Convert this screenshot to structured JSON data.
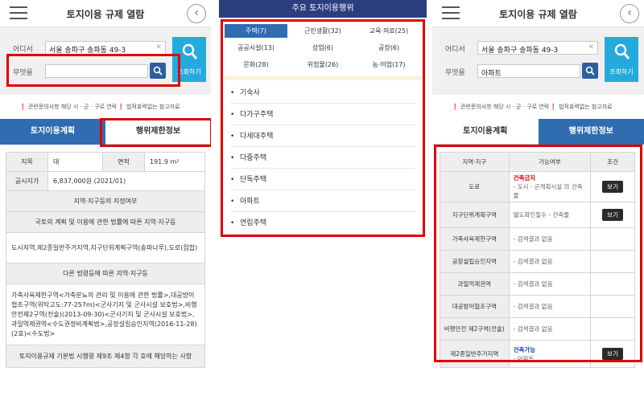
{
  "panel1": {
    "header": {
      "title": "토지이용 규제 열람"
    },
    "search": {
      "where_label": "어디서",
      "where_value": "서울 송파구 송파동 49-3",
      "what_label": "무엇을",
      "what_value": "",
      "search_button": "조회하기"
    },
    "notes": {
      "left": "관련문의사항 해당 시 · 군 · 구로 연락",
      "right": "법적효력없는 참고자료"
    },
    "tabs": {
      "left": "토지이용계획",
      "right": "행위제한정보"
    },
    "info": {
      "jimok_label": "지목",
      "jimok_value": "대",
      "area_label": "면적",
      "area_value": "191.9 m²",
      "price_label": "공시지가",
      "price_value": "6,837,000원 (2021/01)",
      "zones_heading": "지역·지구등의 지정여부",
      "law1_heading": "국토의 계획 및 이용에 관한 법률에 따른 지역·지구등",
      "law1_value": "도시지역,제2종일반주거지역,지구단위계획구역(송파나루),도로(접합)",
      "law2_heading": "다른 법령등에 따른 지역·지구등",
      "law2_value": "가축사육제한구역<가축분뇨의 관리 및 이용에 관한 법률>,대공방어협조구역(위탁고도:77-257m)<군사기지 및 군사시설 보호법>,비행안전제2구역(전술)(2013-09-30)<군사기지 및 군사시설 보호법>,과밀억제권역<수도권정비계획법>,공장설립승인지역(2016-11-28)(2호)<수도법>",
      "law3_heading": "토지이용규제 기본법 시행령 제9조 제4항 각 호에 해당하는 사항"
    }
  },
  "panel2": {
    "header": {
      "title": "주요 토지이용행위"
    },
    "chips": [
      {
        "label": "주택(7)",
        "active": true
      },
      {
        "label": "근린생활(32)",
        "active": false
      },
      {
        "label": "교육·의료(25)",
        "active": false
      },
      {
        "label": "공공시설(13)",
        "active": false
      },
      {
        "label": "상업(6)",
        "active": false
      },
      {
        "label": "공장(6)",
        "active": false
      },
      {
        "label": "문화(28)",
        "active": false
      },
      {
        "label": "위험물(26)",
        "active": false
      },
      {
        "label": "농·어업(17)",
        "active": false
      }
    ],
    "items": [
      "기숙사",
      "다가구주택",
      "다세대주택",
      "다중주택",
      "단독주택",
      "아파트",
      "연립주택"
    ]
  },
  "panel3": {
    "header": {
      "title": "토지이용 규제 열람"
    },
    "search": {
      "where_label": "어디서",
      "where_value": "서울 송파구 송파동 49-3",
      "what_label": "무엇을",
      "what_value": "아파트",
      "search_button": "조회하기"
    },
    "notes": {
      "left": "관련문의사항 해당 시 · 군 · 구로 연락",
      "right": "법적효력없는 참고자료"
    },
    "tabs": {
      "left": "토지이용계획",
      "right": "행위제한정보"
    },
    "table": {
      "headers": [
        "지역·지구",
        "가능여부",
        "조건"
      ],
      "rows": [
        {
          "zone": "도로",
          "status": "건축금지",
          "detail": "- 도시 · 군계획시설 의 건축물",
          "button": "보기"
        },
        {
          "zone": "지구단위계획구역",
          "status": "",
          "detail": "별도확인필수 - 건축물",
          "button": "보기"
        },
        {
          "zone": "가축사육제한구역",
          "status": "",
          "detail": "- 검색결과 없음",
          "button": ""
        },
        {
          "zone": "공장설립승인지역",
          "status": "",
          "detail": "- 검색결과 없음",
          "button": ""
        },
        {
          "zone": "과밀억제권역",
          "status": "",
          "detail": "- 검색결과 없음",
          "button": ""
        },
        {
          "zone": "대공방어협조구역",
          "status": "",
          "detail": "- 검색결과 없음",
          "button": ""
        },
        {
          "zone": "비행안전 제2구역(전술)",
          "status": "",
          "detail": "- 검색결과 없음",
          "button": ""
        },
        {
          "zone": "제2종일반주거지역",
          "status": "건축가능",
          "detail": "- 아파트",
          "button": "보기"
        }
      ]
    }
  },
  "colors": {
    "tab_active": "#2f6cb0",
    "search_button": "#25aadd",
    "panel2_header": "#2d3e80",
    "highlight_red": "#e00000",
    "status_forbidden": "#d20000",
    "status_allowed": "#1a3cb0"
  }
}
